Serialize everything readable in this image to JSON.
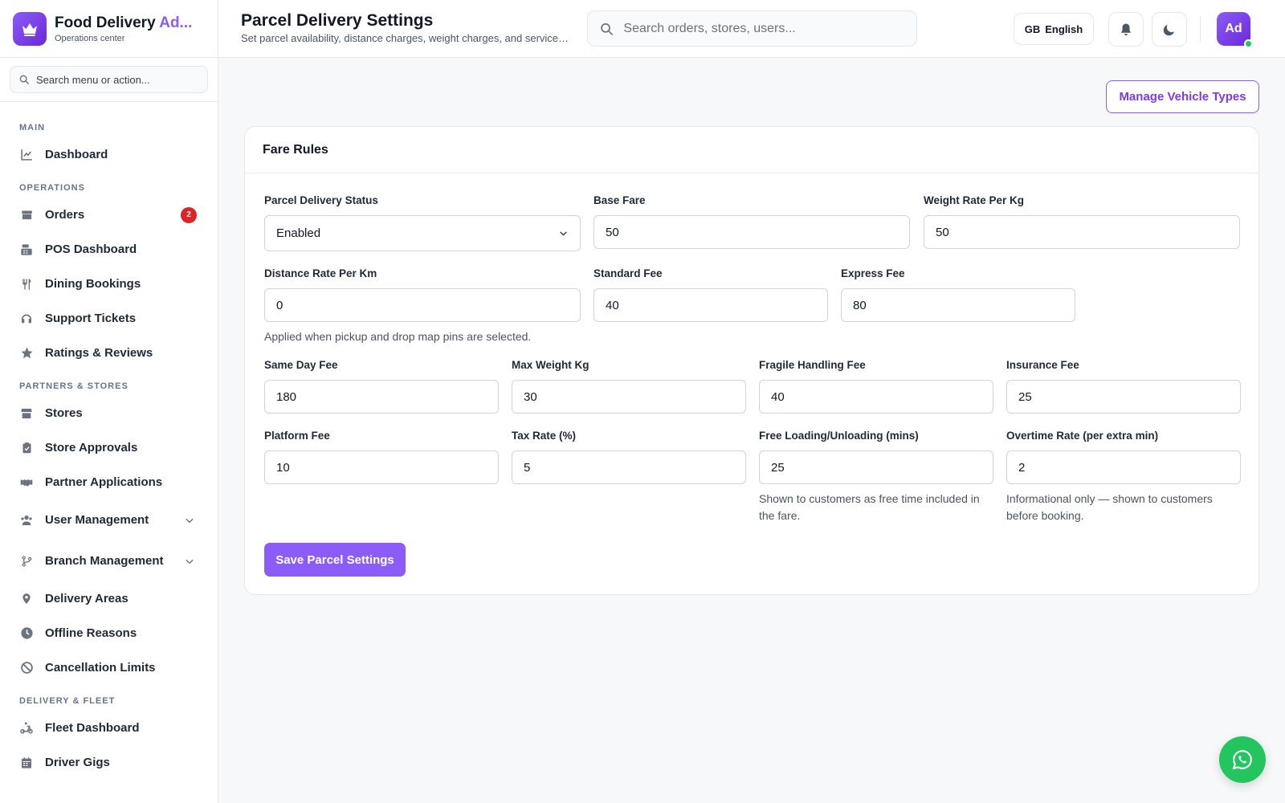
{
  "brand": {
    "title_main": "Food Delivery ",
    "title_accent": "Ad...",
    "subtitle": "Operations center"
  },
  "sidebar": {
    "search_placeholder": "Search menu or action...",
    "sections": [
      {
        "label": "MAIN",
        "items": [
          {
            "label": "Dashboard",
            "icon": "chart-line-icon"
          }
        ]
      },
      {
        "label": "OPERATIONS",
        "items": [
          {
            "label": "Orders",
            "icon": "box-icon",
            "badge": "2"
          },
          {
            "label": "POS Dashboard",
            "icon": "cash-register-icon"
          },
          {
            "label": "Dining Bookings",
            "icon": "utensils-icon"
          },
          {
            "label": "Support Tickets",
            "icon": "headset-icon"
          },
          {
            "label": "Ratings & Reviews",
            "icon": "star-icon"
          }
        ]
      },
      {
        "label": "PARTNERS & STORES",
        "items": [
          {
            "label": "Stores",
            "icon": "store-icon"
          },
          {
            "label": "Store Approvals",
            "icon": "clipboard-check-icon"
          },
          {
            "label": "Partner Applications",
            "icon": "handshake-icon"
          },
          {
            "label": "User Management",
            "icon": "users-icon",
            "expandable": true
          },
          {
            "label": "Branch Management",
            "icon": "branch-icon",
            "expandable": true
          },
          {
            "label": "Delivery Areas",
            "icon": "map-pin-icon"
          },
          {
            "label": "Offline Reasons",
            "icon": "clock-icon"
          },
          {
            "label": "Cancellation Limits",
            "icon": "ban-icon"
          }
        ]
      },
      {
        "label": "DELIVERY & FLEET",
        "items": [
          {
            "label": "Fleet Dashboard",
            "icon": "scooter-icon"
          },
          {
            "label": "Driver Gigs",
            "icon": "calendar-icon"
          }
        ]
      }
    ]
  },
  "header": {
    "title": "Parcel Delivery Settings",
    "subtitle": "Set parcel availability, distance charges, weight charges, and service fees",
    "search_placeholder": "Search orders, stores, users...",
    "language_code": "GB",
    "language": "English",
    "avatar_initials": "Ad"
  },
  "actions": {
    "manage_vehicle_types": "Manage Vehicle Types"
  },
  "fare_rules": {
    "title": "Fare Rules",
    "parcel_status": {
      "label": "Parcel Delivery Status",
      "value": "Enabled"
    },
    "base_fare": {
      "label": "Base Fare",
      "value": "50"
    },
    "weight_rate": {
      "label": "Weight Rate Per Kg",
      "value": "50"
    },
    "distance_rate": {
      "label": "Distance Rate Per Km",
      "value": "0",
      "hint": "Applied when pickup and drop map pins are selected."
    },
    "standard_fee": {
      "label": "Standard Fee",
      "value": "40"
    },
    "express_fee": {
      "label": "Express Fee",
      "value": "80"
    },
    "same_day_fee": {
      "label": "Same Day Fee",
      "value": "180"
    },
    "max_weight": {
      "label": "Max Weight Kg",
      "value": "30"
    },
    "fragile_fee": {
      "label": "Fragile Handling Fee",
      "value": "40"
    },
    "insurance_fee": {
      "label": "Insurance Fee",
      "value": "25"
    },
    "platform_fee": {
      "label": "Platform Fee",
      "value": "10"
    },
    "tax_rate": {
      "label": "Tax Rate (%)",
      "value": "5"
    },
    "free_loading": {
      "label": "Free Loading/Unloading (mins)",
      "value": "25",
      "hint": "Shown to customers as free time included in the fare."
    },
    "overtime_rate": {
      "label": "Overtime Rate (per extra min)",
      "value": "2",
      "hint": "Informational only — shown to customers before booking."
    },
    "save_label": "Save Parcel Settings"
  },
  "colors": {
    "accent": "#8b5cf6",
    "badge": "#dc2626",
    "chat_fab": "#22c55e"
  }
}
